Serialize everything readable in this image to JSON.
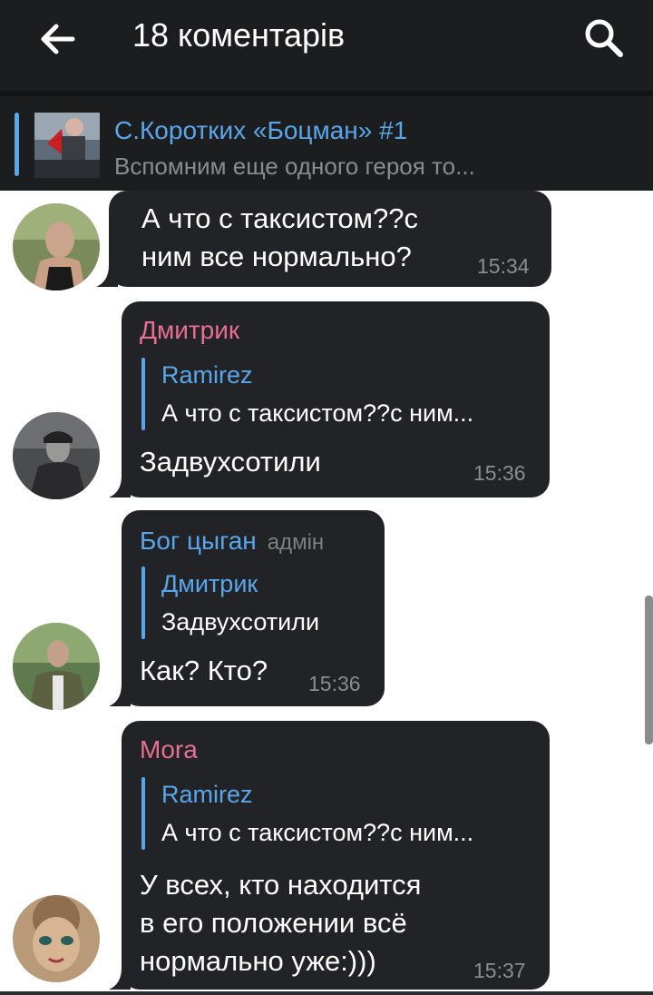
{
  "header": {
    "title": "18 коментарів",
    "back_icon": "arrow-left-icon",
    "search_icon": "search-icon"
  },
  "pinned": {
    "title": "С.Коротких «Боцман» #1",
    "subtitle": "Вспомним еще одного героя то..."
  },
  "colors": {
    "background": "#ffffff",
    "bar": "#1c1d1f",
    "bubble": "#222326",
    "accent_blue": "#5aa6ea",
    "pink": "#e86f92",
    "muted": "#8a8c90"
  },
  "messages": [
    {
      "text": "А что с таксистом??с\nним все нормально?",
      "time": "15:34"
    },
    {
      "sender": "Дмитрик",
      "quote": {
        "name": "Ramirez",
        "text": "А что с таксистом??с ним..."
      },
      "text": "Задвухсотили",
      "time": "15:36"
    },
    {
      "sender": "Бог цыган",
      "role": "адмін",
      "quote": {
        "name": "Дмитрик",
        "text": "Задвухсотили"
      },
      "text": "Как? Кто?",
      "time": "15:36"
    },
    {
      "sender": "Mora",
      "quote": {
        "name": "Ramirez",
        "text": "А что с таксистом??с ним..."
      },
      "text": "У всех, кто находится\nв его положении всё\nнормально уже:)))",
      "time": "15:37"
    }
  ]
}
